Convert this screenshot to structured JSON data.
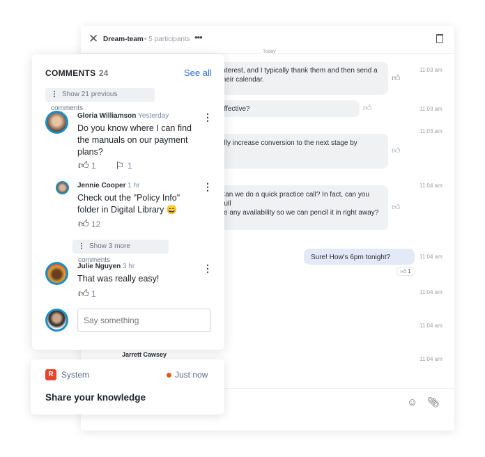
{
  "chat": {
    "title": "Dream-team",
    "participants": "5 participants",
    "date_divider": "Today",
    "messages": [
      {
        "text1": "interest, and I typically thank them and then send a",
        "text2": "their calendar.",
        "time": "11:03 am"
      },
      {
        "text1": "effective?",
        "time": "11:03 am"
      },
      {
        "text1": "ally increase conversion to the next stage by",
        "time": "11:03 am"
      },
      {
        "text1": "Can we do a quick practice call? In fact, can you pull",
        "text2": "ve any availability so we can pencil it in right away?",
        "time": "11:04 am"
      },
      {
        "text1": "Sure! How's 6pm tonight?",
        "time": "11:04 am",
        "reaction_count": "1"
      }
    ],
    "extra_times": [
      "11:04 am",
      "11:04 am",
      "11:04 am"
    ],
    "sender_name": "Jarrett Cawsey"
  },
  "comments": {
    "title": "COMMENTS",
    "count": "24",
    "see_all": "See all",
    "show_previous": "Show 21 previous comments",
    "show_more": "Show 3 more comments",
    "items": [
      {
        "name": "Gloria Williamson",
        "when": "Yesterday",
        "text": "Do you know where I can find the manuals on our payment plans?",
        "likes": "1",
        "flags": "1"
      },
      {
        "name": "Jennie Cooper",
        "when": "1 hr",
        "text": "Check out the \"Policy Info\" folder in Digital Library 😄",
        "likes": "12"
      },
      {
        "name": "Julie Nguyen",
        "when": "3 hr",
        "text": "That was really easy!",
        "likes": "1"
      }
    ],
    "input_placeholder": "Say something"
  },
  "system": {
    "label": "System",
    "when": "Just now",
    "message": "Share your knowledge",
    "status_color": "#d9601a",
    "brand_color": "#e8452c"
  },
  "accent": "#2f6fdb"
}
